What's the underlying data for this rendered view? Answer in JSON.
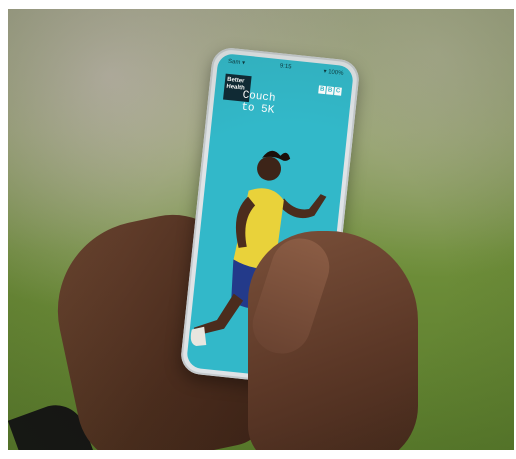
{
  "app": {
    "status": {
      "left": "Sam ▾",
      "time": "9:15",
      "right": "▾ 100%"
    },
    "brand_logo": [
      "Better",
      "Health"
    ],
    "title_lines": [
      "Couch",
      "to 5K"
    ],
    "bbc_logo": [
      "B",
      "B",
      "C"
    ]
  },
  "colors": {
    "screen_bg": "#32b8c9",
    "vest": "#e9d23a",
    "shorts": "#233a8a",
    "skin": "#5a3826"
  },
  "icons": [
    "runner-illustration",
    "bbc-logo",
    "better-health-logo"
  ]
}
